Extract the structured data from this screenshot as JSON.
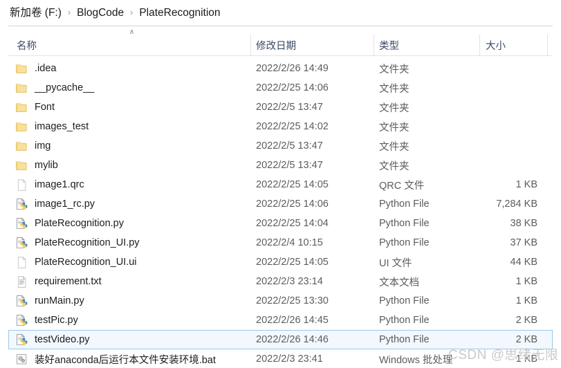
{
  "breadcrumb": {
    "separator": "›",
    "items": [
      "新加卷 (F:)",
      "BlogCode",
      "PlateRecognition"
    ]
  },
  "columns": {
    "sort_caret": "∧",
    "name": "名称",
    "date": "修改日期",
    "type": "类型",
    "size": "大小"
  },
  "rows": [
    {
      "icon": "folder-icon",
      "name": ".idea",
      "date": "2022/2/26 14:49",
      "type": "文件夹",
      "size": "",
      "selected": false
    },
    {
      "icon": "folder-icon",
      "name": "__pycache__",
      "date": "2022/2/25 14:06",
      "type": "文件夹",
      "size": "",
      "selected": false
    },
    {
      "icon": "folder-icon",
      "name": "Font",
      "date": "2022/2/5 13:47",
      "type": "文件夹",
      "size": "",
      "selected": false
    },
    {
      "icon": "folder-icon",
      "name": "images_test",
      "date": "2022/2/25 14:02",
      "type": "文件夹",
      "size": "",
      "selected": false
    },
    {
      "icon": "folder-icon",
      "name": "img",
      "date": "2022/2/5 13:47",
      "type": "文件夹",
      "size": "",
      "selected": false
    },
    {
      "icon": "folder-icon",
      "name": "mylib",
      "date": "2022/2/5 13:47",
      "type": "文件夹",
      "size": "",
      "selected": false
    },
    {
      "icon": "blank-file-icon",
      "name": "image1.qrc",
      "date": "2022/2/25 14:05",
      "type": "QRC 文件",
      "size": "1 KB",
      "selected": false
    },
    {
      "icon": "python-file-icon",
      "name": "image1_rc.py",
      "date": "2022/2/25 14:06",
      "type": "Python File",
      "size": "7,284 KB",
      "selected": false
    },
    {
      "icon": "python-file-icon",
      "name": "PlateRecognition.py",
      "date": "2022/2/25 14:04",
      "type": "Python File",
      "size": "38 KB",
      "selected": false
    },
    {
      "icon": "python-file-icon",
      "name": "PlateRecognition_UI.py",
      "date": "2022/2/4 10:15",
      "type": "Python File",
      "size": "37 KB",
      "selected": false
    },
    {
      "icon": "blank-file-icon",
      "name": "PlateRecognition_UI.ui",
      "date": "2022/2/25 14:05",
      "type": "UI 文件",
      "size": "44 KB",
      "selected": false
    },
    {
      "icon": "text-file-icon",
      "name": "requirement.txt",
      "date": "2022/2/3 23:14",
      "type": "文本文档",
      "size": "1 KB",
      "selected": false
    },
    {
      "icon": "python-file-icon",
      "name": "runMain.py",
      "date": "2022/2/25 13:30",
      "type": "Python File",
      "size": "1 KB",
      "selected": false
    },
    {
      "icon": "python-file-icon",
      "name": "testPic.py",
      "date": "2022/2/26 14:45",
      "type": "Python File",
      "size": "2 KB",
      "selected": false
    },
    {
      "icon": "python-file-icon",
      "name": "testVideo.py",
      "date": "2022/2/26 14:46",
      "type": "Python File",
      "size": "2 KB",
      "selected": true
    },
    {
      "icon": "batch-file-icon",
      "name": "装好anaconda后运行本文件安装环境.bat",
      "date": "2022/2/3 23:41",
      "type": "Windows 批处理",
      "size": "1 KB",
      "selected": false
    }
  ],
  "watermark": {
    "text": "CSDN @思绪无限"
  },
  "colors": {
    "header_text": "#3a4a66",
    "row_text": "#1c1c1c",
    "meta_text": "#5c5c5c",
    "selection_bg": "#f2f8fd",
    "selection_border": "#98c8ec",
    "folder_yellow": "#f5d87e"
  }
}
